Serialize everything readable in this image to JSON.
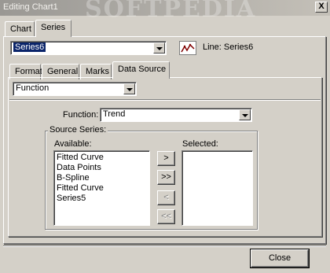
{
  "window": {
    "title": "Editing Chart1",
    "watermark": "SOFTPEDIA",
    "close_glyph": "X"
  },
  "top_tabs": [
    {
      "label": "Chart",
      "active": false
    },
    {
      "label": "Series",
      "active": true
    }
  ],
  "series_select": {
    "value": "Series6"
  },
  "series_label": "Line: Series6",
  "sub_tabs": [
    {
      "label": "Format",
      "active": false
    },
    {
      "label": "General",
      "active": false
    },
    {
      "label": "Marks",
      "active": false
    },
    {
      "label": "Data Source",
      "active": true
    }
  ],
  "source_type_select": {
    "value": "Function"
  },
  "function_row": {
    "label": "Function:",
    "value": "Trend"
  },
  "source_series": {
    "group_label": "Source Series:",
    "available_label": "Available:",
    "selected_label": "Selected:",
    "available_items": [
      "Fitted Curve",
      "Data Points",
      "B-Spline",
      "Fitted Curve",
      "Series5"
    ],
    "selected_items": []
  },
  "move_buttons": [
    {
      "label": ">",
      "enabled": true
    },
    {
      "label": ">>",
      "enabled": true
    },
    {
      "label": "<",
      "enabled": false
    },
    {
      "label": "<<",
      "enabled": false
    }
  ],
  "close_button": "Close",
  "icons": {
    "series_icon": "line-chart-icon",
    "dropdown": "chevron-down-icon",
    "series_color": "#800000"
  }
}
